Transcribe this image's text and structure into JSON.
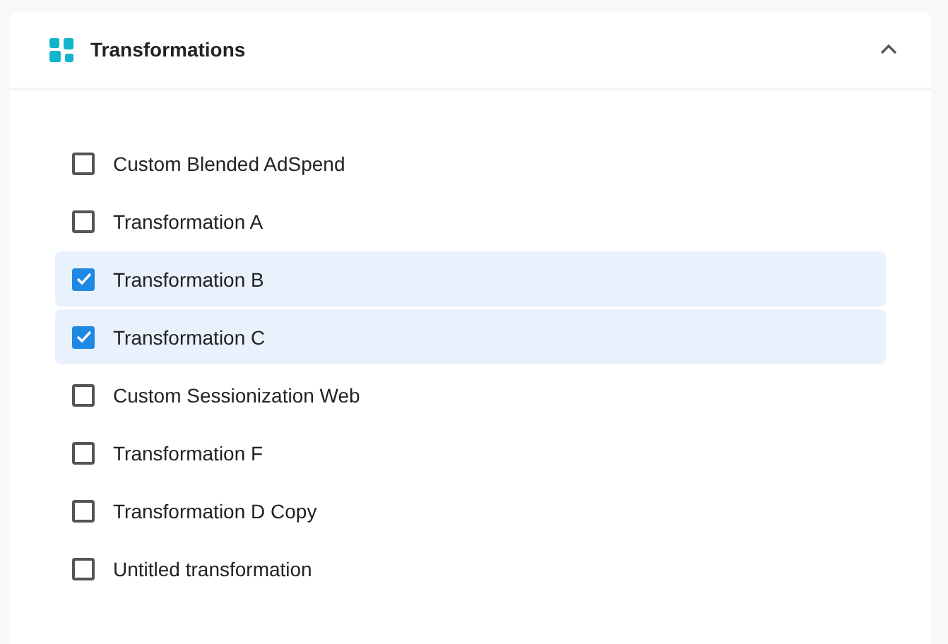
{
  "panel": {
    "title": "Transformations",
    "expanded": true
  },
  "items": [
    {
      "label": "Custom Blended AdSpend",
      "checked": false
    },
    {
      "label": "Transformation A",
      "checked": false
    },
    {
      "label": "Transformation B",
      "checked": true
    },
    {
      "label": "Transformation C",
      "checked": true
    },
    {
      "label": "Custom Sessionization Web",
      "checked": false
    },
    {
      "label": "Transformation F",
      "checked": false
    },
    {
      "label": "Transformation D Copy",
      "checked": false
    },
    {
      "label": "Untitled transformation",
      "checked": false
    }
  ]
}
